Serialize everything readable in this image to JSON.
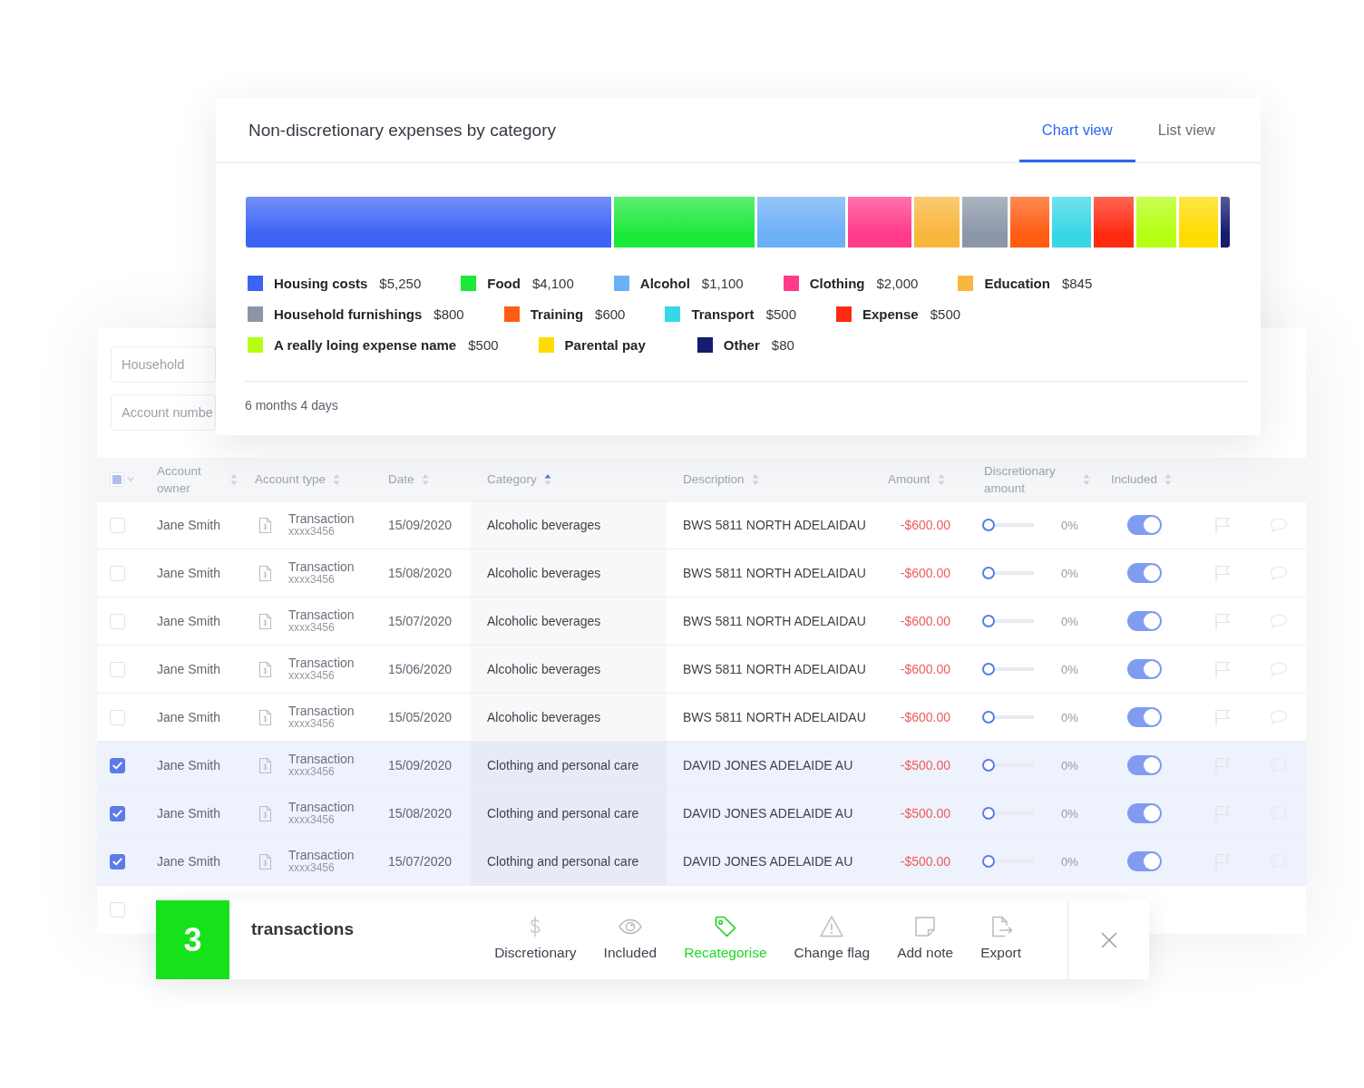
{
  "chart_card": {
    "title": "Non-discretionary expenses by category",
    "tabs": [
      {
        "label": "Chart view",
        "selected": true
      },
      {
        "label": "List view",
        "selected": false
      }
    ],
    "legend": [
      {
        "label": "Housing costs",
        "amount": "$5,250",
        "color": "#3d63f5"
      },
      {
        "label": "Food",
        "amount": "$4,100",
        "color": "#1de93a"
      },
      {
        "label": "Alcohol",
        "amount": "$1,100",
        "color": "#6cb0f5"
      },
      {
        "label": "Clothing",
        "amount": "$2,000",
        "color": "#ff3b8a"
      },
      {
        "label": "Education",
        "amount": "$845",
        "color": "#f9b63c"
      },
      {
        "label": "Household furnishings",
        "amount": "$800",
        "color": "#8b97a8"
      },
      {
        "label": "Training",
        "amount": "$600",
        "color": "#ff5d12"
      },
      {
        "label": "Transport",
        "amount": "$500",
        "color": "#39d6e6"
      },
      {
        "label": "Expense",
        "amount": "$500",
        "color": "#ff2a12"
      },
      {
        "label": "A really loing expense name",
        "amount": "$500",
        "color": "#b5ff12"
      },
      {
        "label": "Parental pay",
        "color": "#ffdc00"
      },
      {
        "label": "Other",
        "amount": "$80",
        "color": "#151b6e"
      }
    ],
    "period": "6 months 4 days"
  },
  "filters": [
    {
      "placeholder": "Household"
    },
    {
      "placeholder": "Account numbe"
    }
  ],
  "table": {
    "select_all": {
      "indeterminate": true
    },
    "columns": [
      {
        "label": "Account owner",
        "sorted": false
      },
      {
        "label": "Account type",
        "sorted": false
      },
      {
        "label": "Date",
        "sorted": false
      },
      {
        "label": "Category",
        "sorted": true
      },
      {
        "label": "Description",
        "sorted": false
      },
      {
        "label": "Amount",
        "sorted": false
      },
      {
        "label": "Discretionary amount",
        "sorted": false
      },
      {
        "label": "Included",
        "sorted": false
      }
    ],
    "rows": [
      {
        "checked": false,
        "owner": "Jane Smith",
        "account_type": "Transaction",
        "account_number": "xxxx3456",
        "date": "15/09/2020",
        "category": "Alcoholic beverages",
        "description": "BWS 5811 NORTH ADELAIDAU",
        "amount": "-$600.00",
        "discretionary": {
          "level": 0,
          "reading": "0%"
        },
        "included": true
      },
      {
        "checked": false,
        "owner": "Jane Smith",
        "account_type": "Transaction",
        "account_number": "xxxx3456",
        "date": "15/08/2020",
        "category": "Alcoholic beverages",
        "description": "BWS 5811 NORTH ADELAIDAU",
        "amount": "-$600.00",
        "discretionary": {
          "level": 0,
          "reading": "0%"
        },
        "included": true
      },
      {
        "checked": false,
        "owner": "Jane Smith",
        "account_type": "Transaction",
        "account_number": "xxxx3456",
        "date": "15/07/2020",
        "category": "Alcoholic beverages",
        "description": "BWS 5811 NORTH ADELAIDAU",
        "amount": "-$600.00",
        "discretionary": {
          "level": 0,
          "reading": "0%"
        },
        "included": true
      },
      {
        "checked": false,
        "owner": "Jane Smith",
        "account_type": "Transaction",
        "account_number": "xxxx3456",
        "date": "15/06/2020",
        "category": "Alcoholic beverages",
        "description": "BWS 5811 NORTH ADELAIDAU",
        "amount": "-$600.00",
        "discretionary": {
          "level": 0,
          "reading": "0%"
        },
        "included": true
      },
      {
        "checked": false,
        "owner": "Jane Smith",
        "account_type": "Transaction",
        "account_number": "xxxx3456",
        "date": "15/05/2020",
        "category": "Alcoholic beverages",
        "description": "BWS 5811 NORTH ADELAIDAU",
        "amount": "-$600.00",
        "discretionary": {
          "level": 0,
          "reading": "0%"
        },
        "included": true
      },
      {
        "checked": true,
        "owner": "Jane Smith",
        "account_type": "Transaction",
        "account_number": "xxxx3456",
        "date": "15/09/2020",
        "category": "Clothing and personal care",
        "description": "DAVID JONES ADELAIDE AU",
        "amount": "-$500.00",
        "discretionary": {
          "level": 0,
          "reading": "0%"
        },
        "included": true
      },
      {
        "checked": true,
        "owner": "Jane Smith",
        "account_type": "Transaction",
        "account_number": "xxxx3456",
        "date": "15/08/2020",
        "category": "Clothing and personal care",
        "description": "DAVID JONES ADELAIDE AU",
        "amount": "-$500.00",
        "discretionary": {
          "level": 0,
          "reading": "0%"
        },
        "included": true
      },
      {
        "checked": true,
        "owner": "Jane Smith",
        "account_type": "Transaction",
        "account_number": "xxxx3456",
        "date": "15/07/2020",
        "category": "Clothing and personal care",
        "description": "DAVID JONES ADELAIDE AU",
        "amount": "-$500.00",
        "discretionary": {
          "level": 0,
          "reading": "0%"
        },
        "included": true
      },
      {
        "checked": false
      }
    ]
  },
  "action_bar": {
    "count": "3",
    "label": "transactions",
    "actions": [
      {
        "label": "Discretionary",
        "selected": false
      },
      {
        "label": "Included",
        "selected": false
      },
      {
        "label": "Recategorise",
        "selected": true
      },
      {
        "label": "Change flag",
        "selected": false
      },
      {
        "label": "Add note",
        "selected": false
      },
      {
        "label": "Export",
        "selected": false
      }
    ]
  }
}
